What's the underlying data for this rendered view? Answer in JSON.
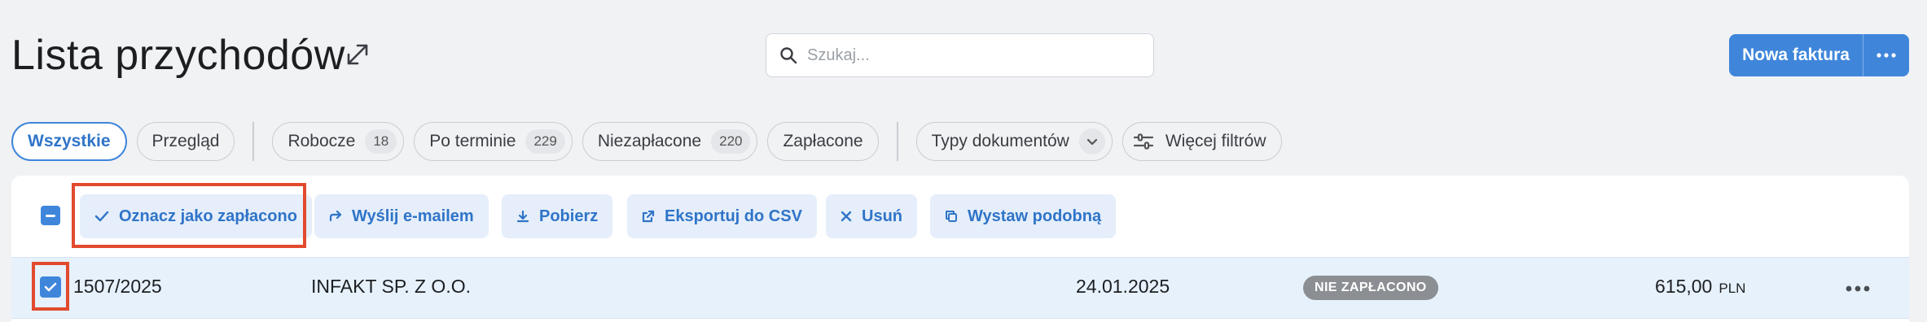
{
  "header": {
    "title": "Lista przychodów",
    "expand_icon": "expand-arrows-icon"
  },
  "search": {
    "placeholder": "Szukaj...",
    "value": ""
  },
  "new_invoice": {
    "label": "Nowa faktura",
    "more_icon": "more-dots-icon"
  },
  "filters": [
    {
      "label": "Wszystkie",
      "active": true
    },
    {
      "label": "Przegląd"
    },
    {
      "label": "Robocze",
      "count": "18"
    },
    {
      "label": "Po terminie",
      "count": "229"
    },
    {
      "label": "Niezapłacone",
      "count": "220"
    },
    {
      "label": "Zapłacone"
    },
    {
      "label": "Typy dokumentów"
    },
    {
      "label": "Więcej filtrów"
    }
  ],
  "bulk_actions": [
    {
      "label": "Oznacz jako zapłacono",
      "icon": "check-icon"
    },
    {
      "label": "Wyślij e-mailem",
      "icon": "forward-icon"
    },
    {
      "label": "Pobierz",
      "icon": "download-icon"
    },
    {
      "label": "Eksportuj do CSV",
      "icon": "export-icon"
    },
    {
      "label": "Usuń",
      "icon": "close-icon"
    },
    {
      "label": "Wystaw podobną",
      "icon": "copy-icon"
    }
  ],
  "rows": [
    {
      "number": "1507/2025",
      "client": "INFAKT SP. Z O.O.",
      "date": "24.01.2025",
      "status": "NIE ZAPŁACONO",
      "amount": "615,00",
      "currency": "PLN",
      "selected": true
    }
  ],
  "colors": {
    "accent": "#3f86db",
    "highlight": "#e24a2e",
    "row_selected": "#e6f1fb"
  }
}
